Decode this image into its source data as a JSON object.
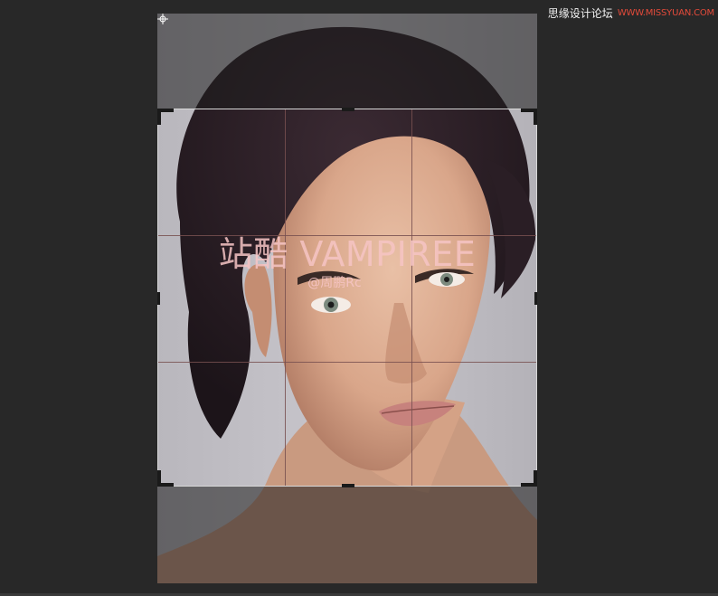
{
  "watermark": {
    "site_name": "思缘设计论坛",
    "site_url": "WWW.MISSYUAN.COM"
  },
  "overlay": {
    "title": "站酷 VAMPIREE",
    "author": "@周鹏Rc"
  },
  "colors": {
    "workspace_bg": "#282828",
    "overlay_text": "#f6c4c4",
    "watermark_url": "#e34a3a"
  },
  "icons": {
    "crop_handles": "crop-handle-icon",
    "center_target": "crosshair-icon"
  }
}
